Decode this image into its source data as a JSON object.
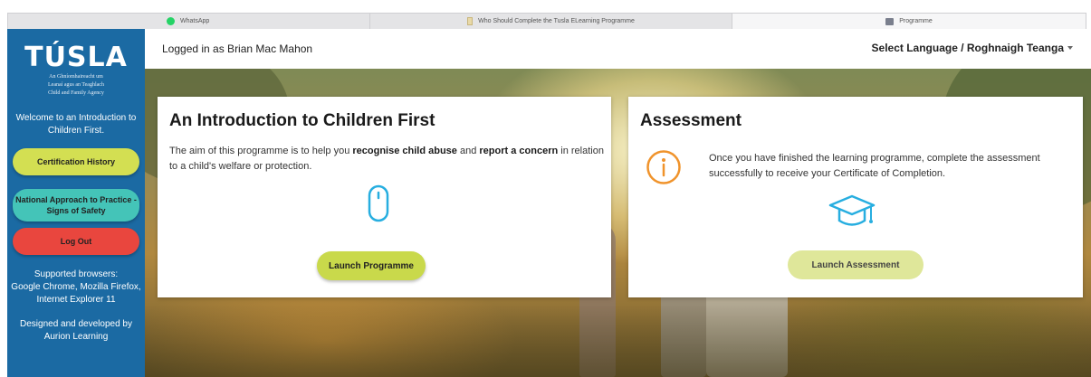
{
  "tabs": [
    {
      "label": "WhatsApp",
      "icon": "whatsapp-icon"
    },
    {
      "label": "Who Should Complete the Tusla ELearning Programme",
      "icon": "document-icon"
    },
    {
      "label": "Programme",
      "icon": "programme-icon"
    }
  ],
  "sidebar": {
    "logo_title": "TÚSLA",
    "logo_sub_line1": "An Ghníomhaireacht um",
    "logo_sub_line2": "Leanaí agus an Teaghlach",
    "logo_sub_line3": "Child and Family Agency",
    "welcome": "Welcome to an Introduction to Children First.",
    "cert_button": "Certification History",
    "national_button": "National Approach to Practice - Signs of Safety",
    "logout_button": "Log Out",
    "browsers_label": "Supported browsers:",
    "browsers_list": "Google Chrome, Mozilla Firefox, Internet Explorer 11",
    "designed": "Designed and developed by Aurion Learning"
  },
  "topbar": {
    "logged_in": "Logged in as Brian Mac Mahon",
    "language": "Select Language / Roghnaigh Teanga"
  },
  "programme_card": {
    "title": "An Introduction to Children First",
    "text_1": "The aim of this programme is to help you ",
    "text_bold_1": "recognise child abuse",
    "text_2": " and ",
    "text_bold_2": "report a concern",
    "text_3": " in relation to a child's welfare or protection.",
    "button": "Launch Programme"
  },
  "assessment_card": {
    "title": "Assessment",
    "text": "Once you have finished the learning programme, complete the assessment successfully to receive your Certificate of Completion.",
    "button": "Launch Assessment"
  },
  "colors": {
    "sidebar": "#1b6aa3",
    "cert_button": "#d3df52",
    "national_button": "#44c4b8",
    "logout_button": "#e9463e",
    "launch_programme": "#c9d94b",
    "launch_assessment": "#dfe79a",
    "info_icon": "#f0932b",
    "mouse_icon": "#27aee0"
  }
}
